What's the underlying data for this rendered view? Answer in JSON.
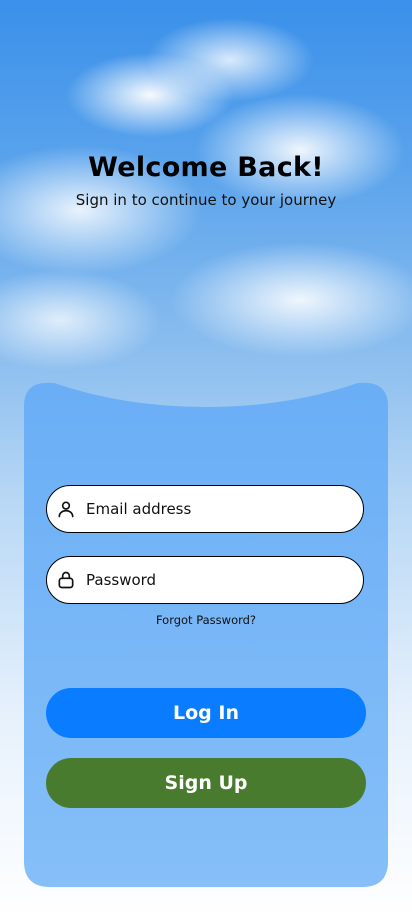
{
  "header": {
    "title": "Welcome Back!",
    "subtitle": "Sign in to continue to your journey"
  },
  "form": {
    "email": {
      "placeholder": "Email address",
      "value": "",
      "icon": "user-icon"
    },
    "password": {
      "placeholder": "Password",
      "value": "",
      "icon": "lock-icon"
    },
    "forgot_label": "Forgot Password?",
    "login_label": "Log In",
    "signup_label": "Sign Up"
  },
  "colors": {
    "card": "#7ab7f7",
    "login_button": "#0a7cff",
    "signup_button": "#497b2e"
  }
}
